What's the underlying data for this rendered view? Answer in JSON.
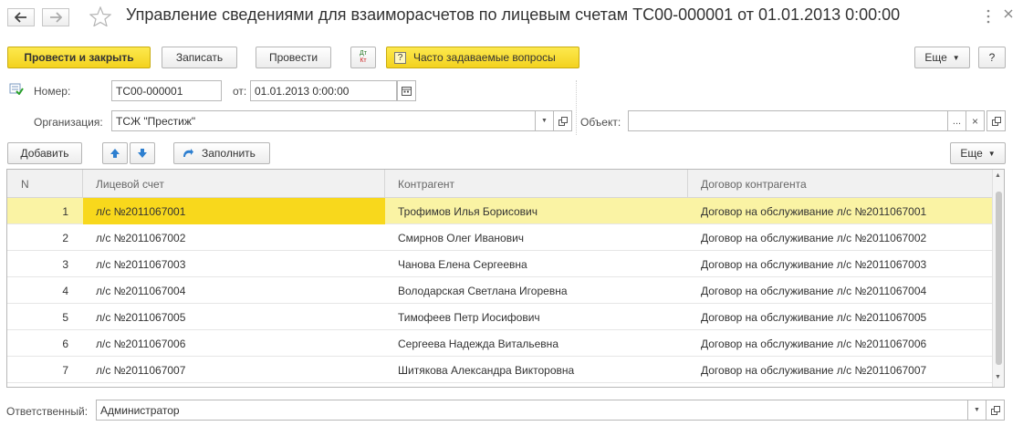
{
  "window": {
    "title": "Управление сведениями для взаиморасчетов по лицевым счетам ТС00-000001 от 01.01.2013 0:00:00",
    "back_icon": "arrow-left",
    "forward_icon": "arrow-right",
    "favorite_icon": "star",
    "more_icon": "vertical-dots",
    "close_icon": "x"
  },
  "toolbar": {
    "post_close": "Провести и закрыть",
    "save": "Записать",
    "post": "Провести",
    "dtkt_top": "Дт",
    "dtkt_bottom": "Кт",
    "faq_icon": "?",
    "faq": "Часто задаваемые вопросы",
    "more": "Еще",
    "help": "?"
  },
  "form": {
    "number_label": "Номер:",
    "number_value": "ТС00-000001",
    "date_label": "от:",
    "date_value": "01.01.2013  0:00:00",
    "org_label": "Организация:",
    "org_value": "ТСЖ \"Престиж\"",
    "object_label": "Объект:",
    "object_value": "",
    "object_dots": "...",
    "object_clear": "×",
    "responsible_label": "Ответственный:",
    "responsible_value": "Администратор"
  },
  "table_toolbar": {
    "add": "Добавить",
    "fill": "Заполнить",
    "more": "Еще"
  },
  "table": {
    "columns": [
      "N",
      "Лицевой счет",
      "Контрагент",
      "Договор контрагента"
    ],
    "rows": [
      {
        "n": "1",
        "account": "л/с №2011067001",
        "contractor": "Трофимов Илья Борисович",
        "contract": "Договор на обслуживание л/с №2011067001"
      },
      {
        "n": "2",
        "account": "л/с №2011067002",
        "contractor": "Смирнов Олег Иванович",
        "contract": "Договор на обслуживание л/с №2011067002"
      },
      {
        "n": "3",
        "account": "л/с №2011067003",
        "contractor": "Чанова Елена Сергеевна",
        "contract": "Договор на обслуживание л/с №2011067003"
      },
      {
        "n": "4",
        "account": "л/с №2011067004",
        "contractor": "Володарская Светлана Игоревна",
        "contract": "Договор на обслуживание л/с №2011067004"
      },
      {
        "n": "5",
        "account": "л/с №2011067005",
        "contractor": "Тимофеев Петр Иосифович",
        "contract": "Договор на обслуживание л/с №2011067005"
      },
      {
        "n": "6",
        "account": "л/с №2011067006",
        "contractor": "Сергеева Надежда Витальевна",
        "contract": "Договор на обслуживание л/с №2011067006"
      },
      {
        "n": "7",
        "account": "л/с №2011067007",
        "contractor": "Шитякова Александра Викторовна",
        "contract": "Договор на обслуживание л/с №2011067007"
      }
    ]
  },
  "colors": {
    "accent_yellow": "#f3d21f",
    "selected_row": "#faf3a4",
    "selected_cell": "#f8d81c"
  }
}
